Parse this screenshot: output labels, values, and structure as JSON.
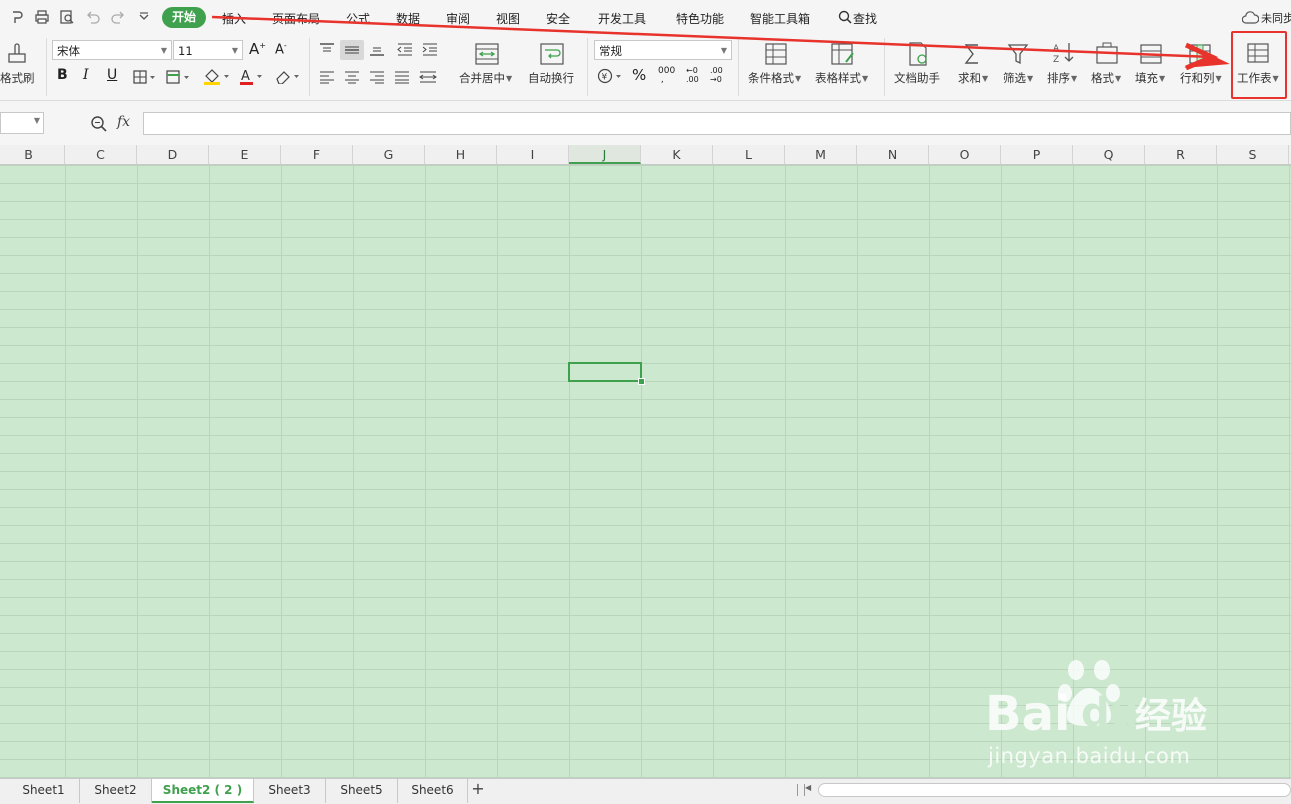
{
  "quick_access": {
    "icons": [
      "spell-check-icon",
      "print-icon",
      "print-preview-icon",
      "undo-icon",
      "redo-icon",
      "more-icon"
    ]
  },
  "menu": {
    "tabs": [
      "开始",
      "插入",
      "页面布局",
      "公式",
      "数据",
      "审阅",
      "视图",
      "安全",
      "开发工具",
      "特色功能",
      "智能工具箱"
    ],
    "search_label": "查找",
    "sync_label": "未同步"
  },
  "ribbon": {
    "format_painter": "格式刷",
    "font_name": "宋体",
    "font_size": "11",
    "merge_center": "合并居中",
    "wrap_text": "自动换行",
    "number_format": "常规",
    "percent": "%",
    "conditional_format": "条件格式",
    "table_style": "表格样式",
    "doc_assistant": "文档助手",
    "sum": "求和",
    "filter": "筛选",
    "sort": "排序",
    "format": "格式",
    "fill": "填充",
    "row_col": "行和列",
    "worksheet": "工作表"
  },
  "formula_bar": {
    "fx_label": "fx",
    "value": ""
  },
  "columns": [
    "B",
    "C",
    "D",
    "E",
    "F",
    "G",
    "H",
    "I",
    "J",
    "K",
    "L",
    "M",
    "N",
    "O",
    "P",
    "Q",
    "R",
    "S"
  ],
  "active_column": "J",
  "sheets": [
    "Sheet1",
    "Sheet2",
    "Sheet2 ( 2 )",
    "Sheet3",
    "Sheet5",
    "Sheet6"
  ],
  "active_sheet": "Sheet2 ( 2 )",
  "add_sheet": "+",
  "watermark": {
    "brand": "Bai 经验",
    "url": "jingyan.baidu.com"
  },
  "colors": {
    "accent": "#3fa14d",
    "grid_bg": "#cce8cf",
    "annotation": "#e8332c"
  }
}
